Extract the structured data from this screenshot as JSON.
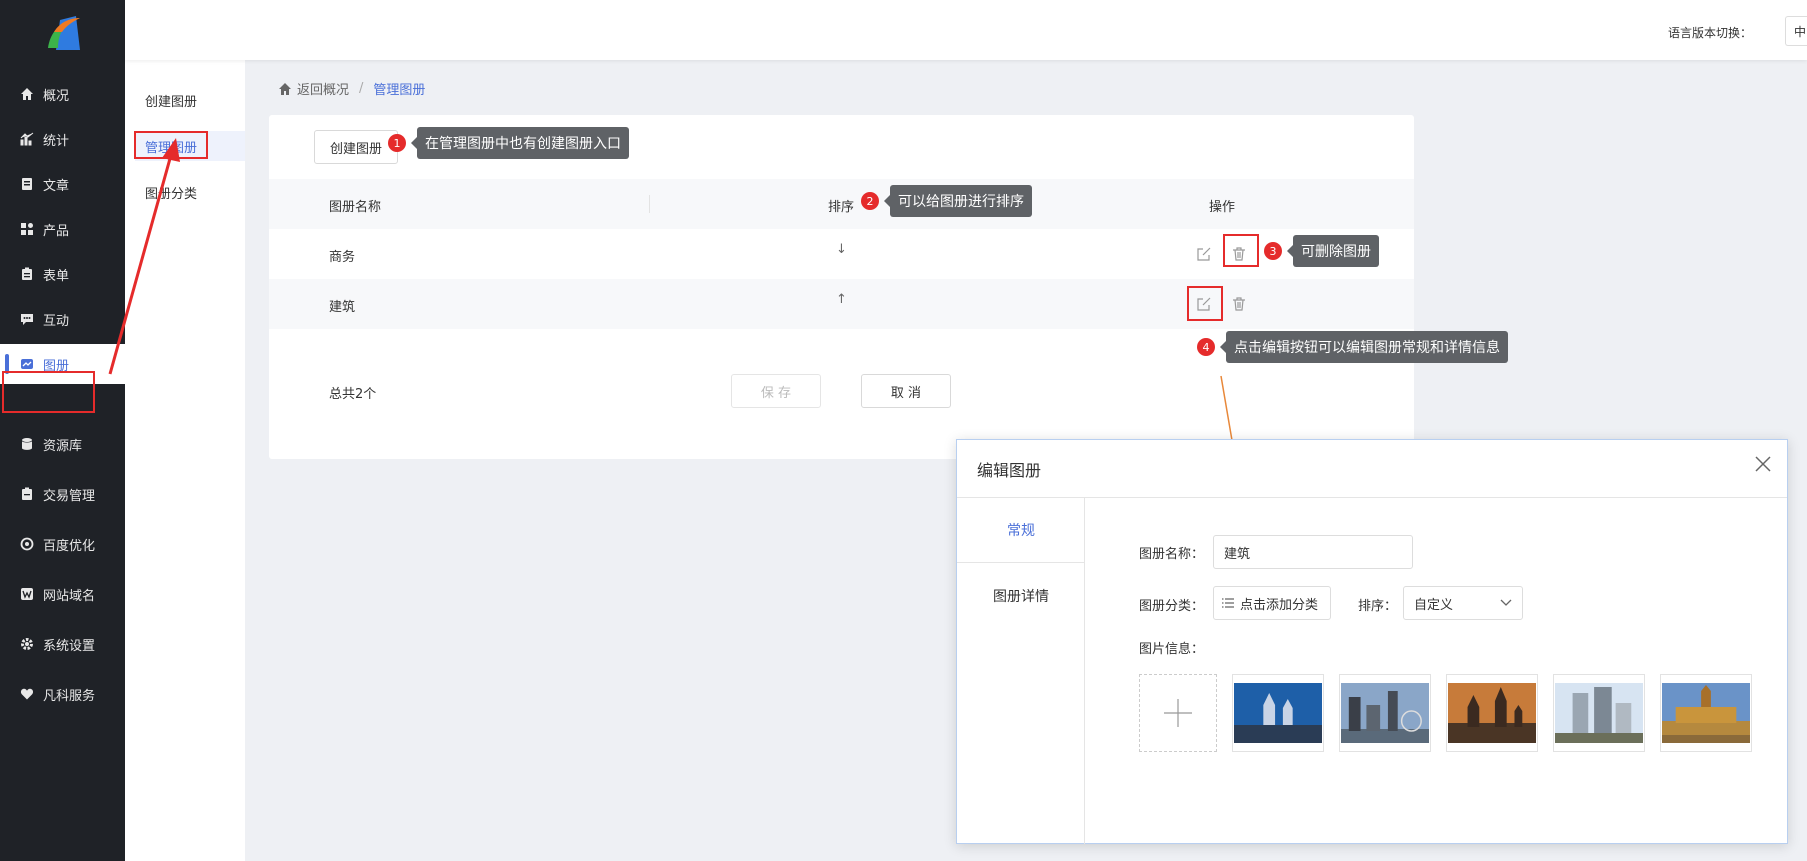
{
  "sidebar": {
    "items": [
      {
        "label": "概况",
        "icon": "home-icon"
      },
      {
        "label": "统计",
        "icon": "chart-icon"
      },
      {
        "label": "文章",
        "icon": "article-icon"
      },
      {
        "label": "产品",
        "icon": "grid-icon"
      },
      {
        "label": "表单",
        "icon": "clipboard-icon"
      },
      {
        "label": "互动",
        "icon": "chat-icon"
      },
      {
        "label": "图册",
        "icon": "album-icon"
      },
      {
        "label": "资源库",
        "icon": "database-icon"
      },
      {
        "label": "交易管理",
        "icon": "order-icon"
      },
      {
        "label": "百度优化",
        "icon": "target-icon"
      },
      {
        "label": "网站域名",
        "icon": "w-icon"
      },
      {
        "label": "系统设置",
        "icon": "gear-icon"
      },
      {
        "label": "凡科服务",
        "icon": "heart-icon"
      }
    ],
    "active_index": 6
  },
  "subnav": {
    "items": [
      "创建图册",
      "管理图册",
      "图册分类"
    ],
    "active_index": 1
  },
  "topbar": {
    "lang_label": "语言版本切换：",
    "lang_value": "中"
  },
  "breadcrumb": {
    "back": "返回概况",
    "sep": "/",
    "current": "管理图册"
  },
  "card": {
    "create_button": "创建图册",
    "columns": {
      "name": "图册名称",
      "order": "排序",
      "actions": "操作"
    },
    "rows": [
      {
        "name": "商务",
        "order_arrow": "↓"
      },
      {
        "name": "建筑",
        "order_arrow": "↑"
      }
    ],
    "total": "总共2个",
    "save_button": "保 存",
    "cancel_button": "取 消"
  },
  "annotations": [
    {
      "num": "1",
      "text": "在管理图册中也有创建图册入口"
    },
    {
      "num": "2",
      "text": "可以给图册进行排序"
    },
    {
      "num": "3",
      "text": "可删除图册"
    },
    {
      "num": "4",
      "text": "点击编辑按钮可以编辑图册常规和详情信息"
    }
  ],
  "dialog": {
    "title": "编辑图册",
    "tabs": [
      "常规",
      "图册详情"
    ],
    "active_tab": 0,
    "name_label": "图册名称：",
    "name_value": "建筑",
    "category_label": "图册分类：",
    "category_button": "点击添加分类",
    "order_label": "排序：",
    "order_value": "自定义",
    "images_label": "图片信息："
  },
  "colors": {
    "accent": "#4a6fd8",
    "sidebar_bg": "#1f2227",
    "annotation_red": "#e52b2b",
    "tooltip_bg": "#5f6266",
    "arrow_orange": "#e8883a"
  }
}
